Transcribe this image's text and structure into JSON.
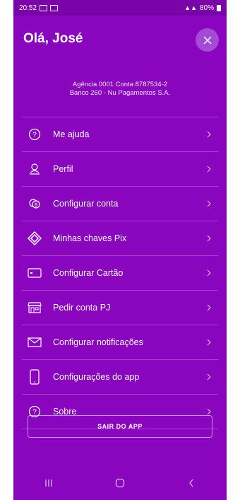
{
  "status_bar": {
    "time": "20:52",
    "battery": "80%"
  },
  "header": {
    "greeting": "Olá, José"
  },
  "account": {
    "line1": "Agência 0001 Conta 8787534-2",
    "line2": "Banco 260 - Nu Pagamentos S.A."
  },
  "menu": [
    {
      "label": "Me ajuda",
      "icon": "help-circle-icon"
    },
    {
      "label": "Perfil",
      "icon": "profile-icon"
    },
    {
      "label": "Configurar conta",
      "icon": "coin-icon"
    },
    {
      "label": "Minhas chaves Pix",
      "icon": "pix-icon"
    },
    {
      "label": "Configurar Cartão",
      "icon": "card-icon"
    },
    {
      "label": "Pedir conta PJ",
      "icon": "store-icon"
    },
    {
      "label": "Configurar notificações",
      "icon": "envelope-icon"
    },
    {
      "label": "Configurações do app",
      "icon": "phone-icon"
    },
    {
      "label": "Sobre",
      "icon": "help-circle-icon"
    }
  ],
  "logout_label": "SAIR DO APP",
  "colors": {
    "background": "#8a05be",
    "close_button": "#a34ad6"
  }
}
